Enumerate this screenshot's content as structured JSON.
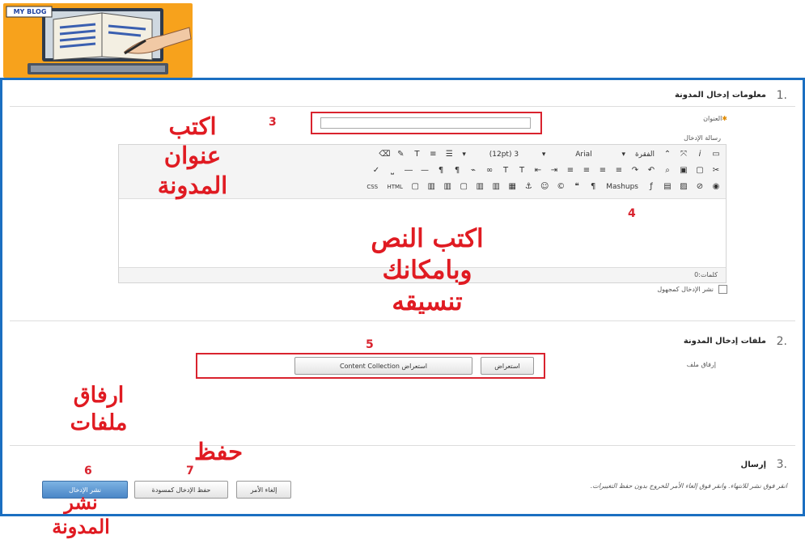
{
  "logo": {
    "text": "MY BLOG"
  },
  "section1": {
    "number": "1.",
    "title": "معلومات إدخال المدونة",
    "title_field_label": "العنوان",
    "entry_message_label": "رسالة الإدخال",
    "toolbar": {
      "paragraph": "الفقرة",
      "font": "Arial",
      "size": "(12pt) 3",
      "mashups": "Mashups",
      "css": "CSS",
      "html": "HTML"
    },
    "word_count": "كلمات:0",
    "anonymous_post": "نشر الإدخال كمجهول"
  },
  "section2": {
    "number": "2.",
    "title": "ملفات إدخال المدونة",
    "attach_label": "إرفاق ملف",
    "browse_computer": "استعراض",
    "browse_content": "استعراض Content Collection"
  },
  "section3": {
    "number": "3.",
    "title": "إرسال",
    "instructions": "انقر فوق نشر للانتهاء. وانقر فوق إلغاء الأمر للخروج بدون حفظ التغييرات.",
    "cancel": "إلغاء الأمر",
    "save_draft": "حفظ الإدخال كمسودة",
    "publish": "نشر الإدخال"
  },
  "annotations": {
    "n3": "3",
    "n4": "4",
    "n5": "5",
    "n6": "6",
    "n7": "7",
    "write_title": "اكتب\nعنوان\nالمدونة",
    "write_text": "اكتب النص\nوبامكانك\nتنسيقه",
    "attach_files": "ارفاق\nملفات",
    "save": "حفظ",
    "publish": "نشر\nالمدونة"
  },
  "colors": {
    "frame": "#1b6fc1",
    "annotation": "#e01b22",
    "logo_bg": "#f7a21c"
  }
}
